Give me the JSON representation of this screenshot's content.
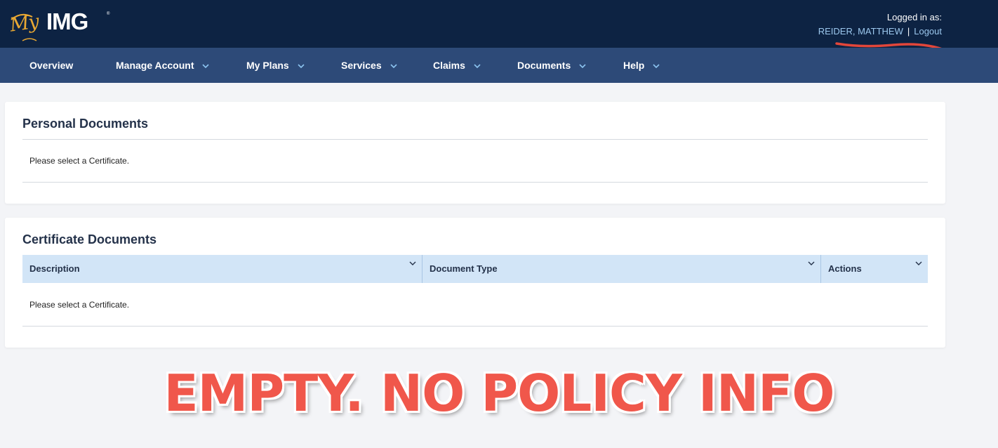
{
  "header": {
    "logo_prefix": "My",
    "logo_main": "IMG",
    "logo_reg": "®",
    "logged_in_label": "Logged in as:",
    "user_name": "REIDER, MATTHEW",
    "separator": "|",
    "logout_label": "Logout"
  },
  "nav": {
    "items": [
      {
        "label": "Overview",
        "has_dropdown": false
      },
      {
        "label": "Manage Account",
        "has_dropdown": true
      },
      {
        "label": "My Plans",
        "has_dropdown": true
      },
      {
        "label": "Services",
        "has_dropdown": true
      },
      {
        "label": "Claims",
        "has_dropdown": true
      },
      {
        "label": "Documents",
        "has_dropdown": true
      },
      {
        "label": "Help",
        "has_dropdown": true
      }
    ]
  },
  "personal_documents": {
    "title": "Personal Documents",
    "message": "Please select a Certificate."
  },
  "certificate_documents": {
    "title": "Certificate Documents",
    "columns": [
      "Description",
      "Document Type",
      "Actions"
    ],
    "message": "Please select a Certificate."
  },
  "annotation": {
    "text": "EMPTY. NO POLICY INFO",
    "color": "#f0574b"
  },
  "colors": {
    "topbar": "#0d2343",
    "navbar": "#2d4a78",
    "link": "#9cc8ee",
    "table_header": "#d2e5f7",
    "brand_gold": "#e8a833"
  }
}
